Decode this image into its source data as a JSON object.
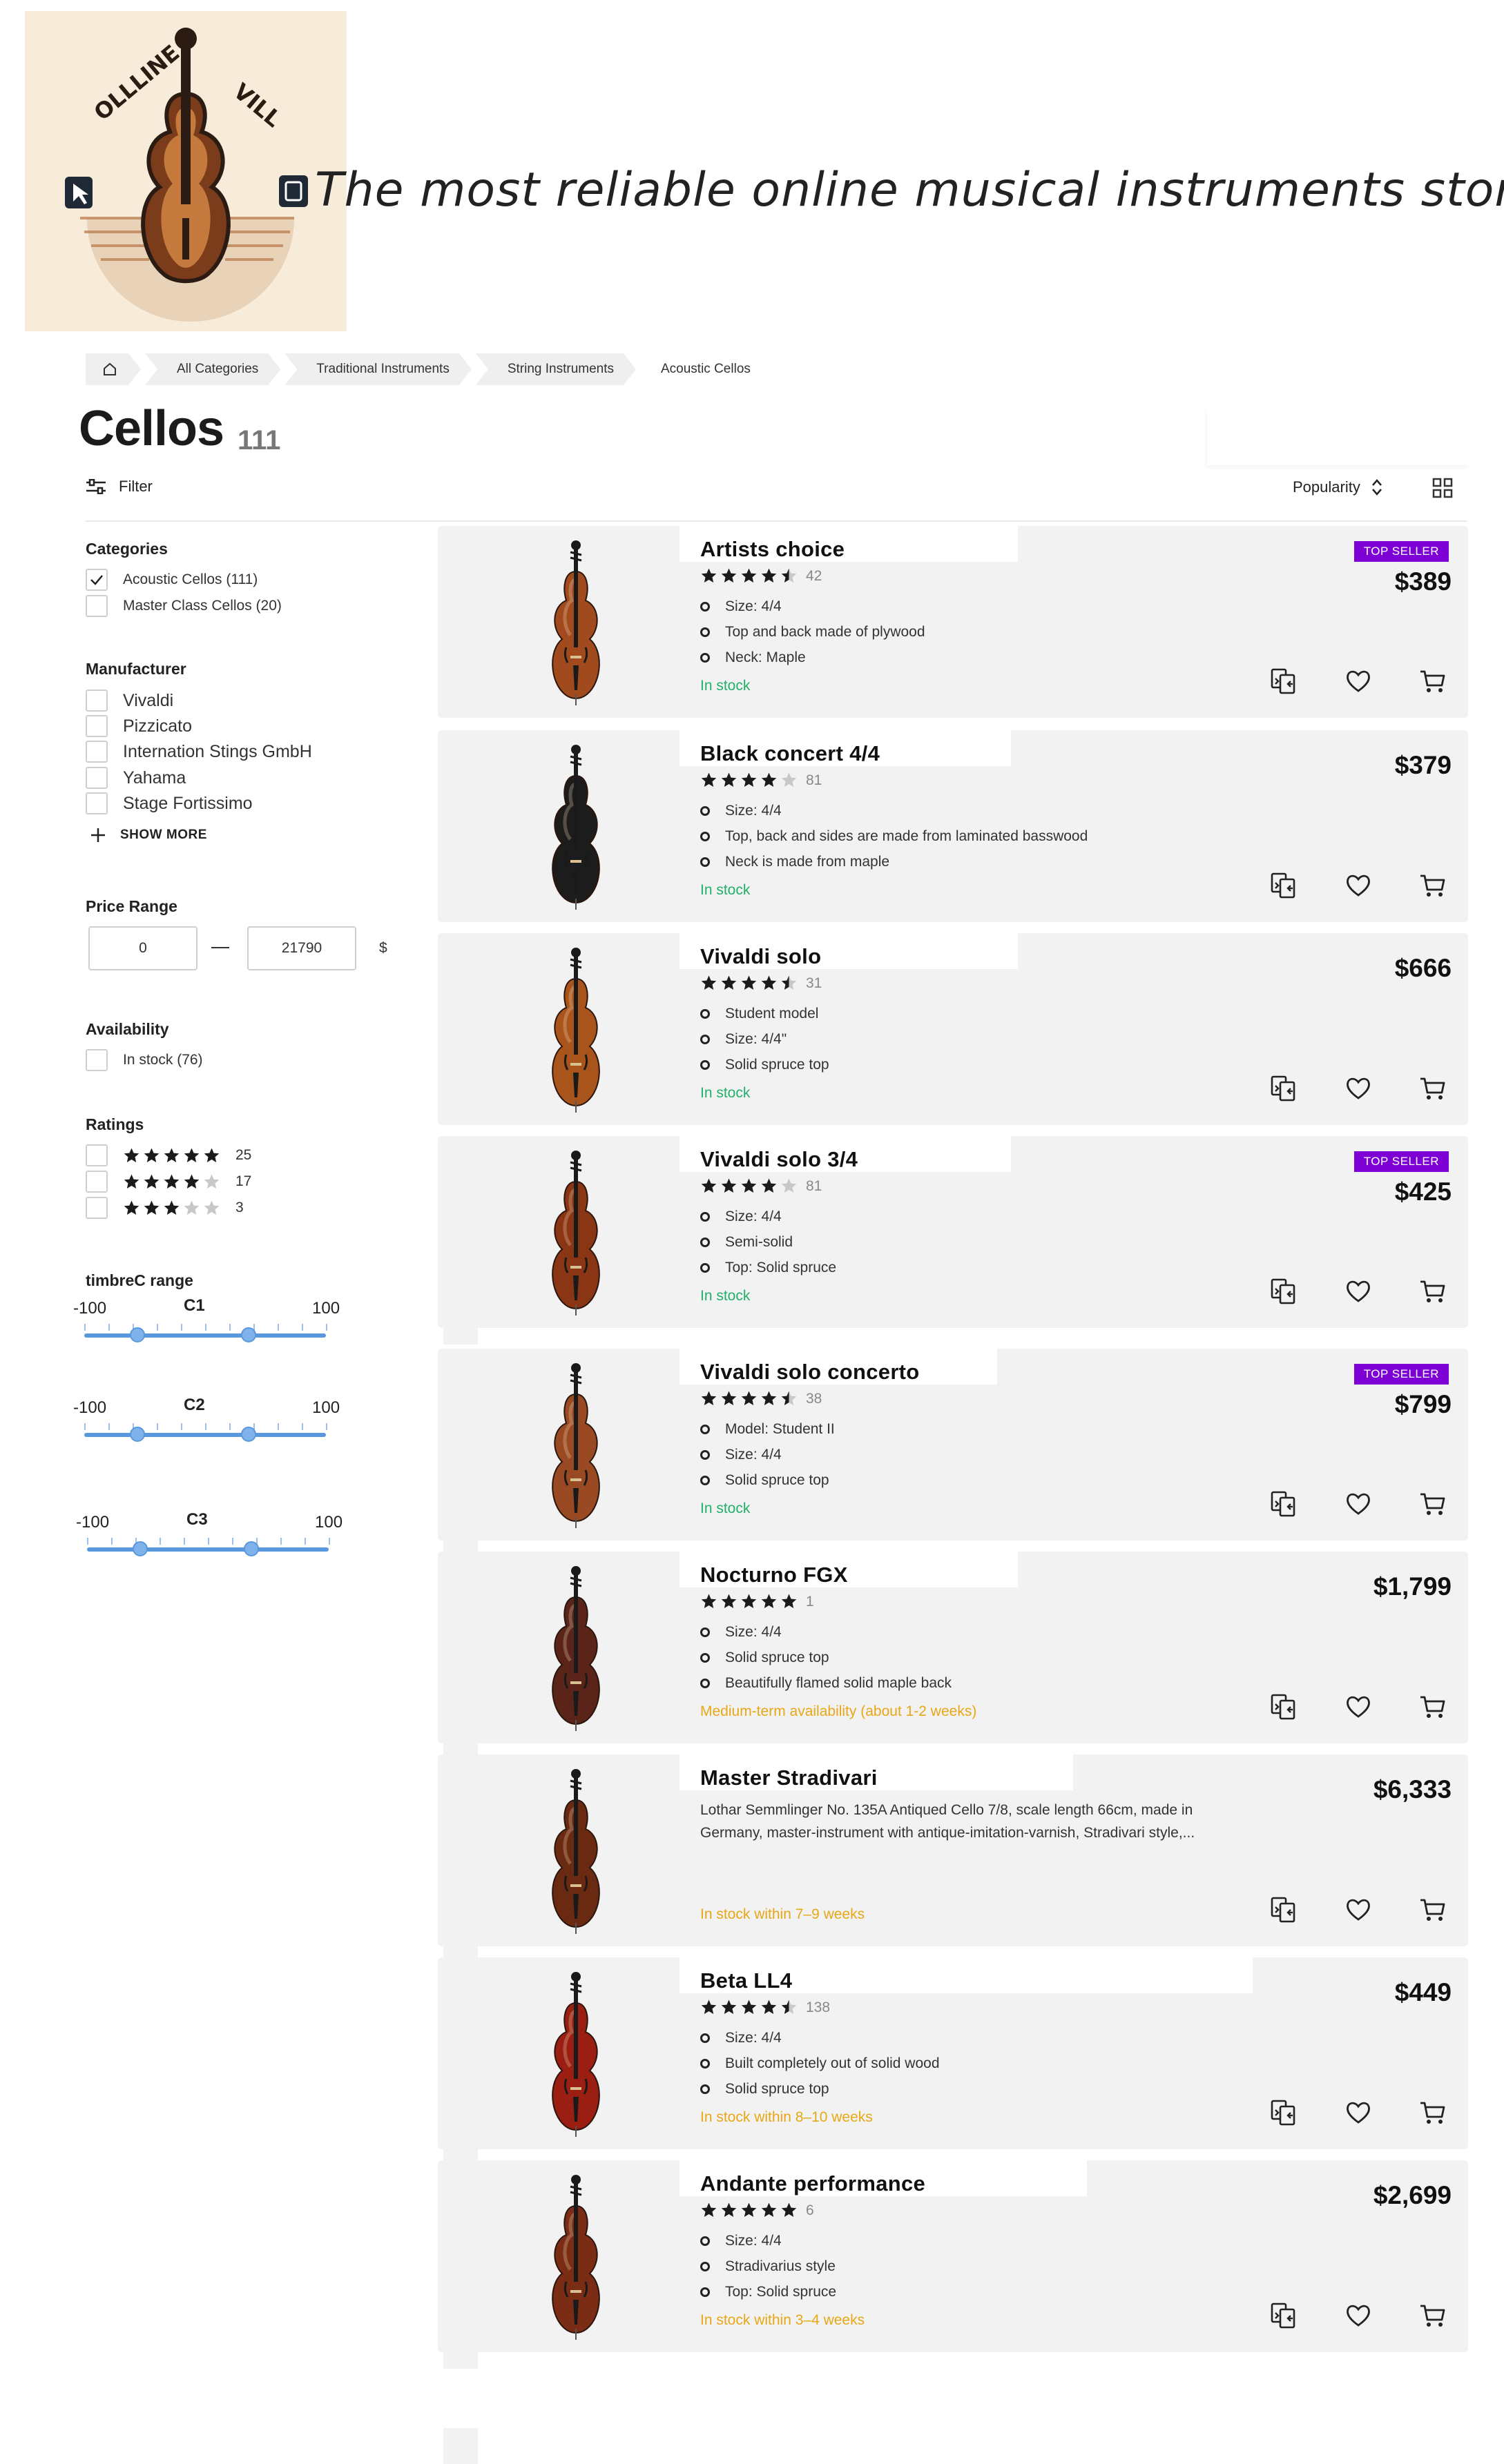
{
  "header": {
    "logo_text": "OLLLINE VILL",
    "tagline": "The most reliable online musical instruments store"
  },
  "breadcrumb": [
    "All Categories",
    "Traditional Instruments",
    "String Instruments",
    "Acoustic Cellos"
  ],
  "page": {
    "title": "Cellos",
    "count": "111"
  },
  "toolbar": {
    "filter_label": "Filter",
    "sort_label": "Popularity"
  },
  "sidebar": {
    "categories": {
      "heading": "Categories",
      "items": [
        {
          "label": "Acoustic Cellos (111)",
          "checked": true
        },
        {
          "label": "Master Class Cellos (20)",
          "checked": false
        }
      ]
    },
    "manufacturer": {
      "heading": "Manufacturer",
      "items": [
        "Vivaldi",
        "Pizzicato",
        "Internation Stings GmbH",
        "Yahama",
        "Stage Fortissimo"
      ],
      "show_more": "SHOW MORE"
    },
    "price": {
      "heading": "Price Range",
      "min": "0",
      "max": "21790",
      "currency": "$"
    },
    "availability": {
      "heading": "Availability",
      "items": [
        "In stock (76)"
      ]
    },
    "ratings": {
      "heading": "Ratings",
      "items": [
        {
          "stars": 5,
          "count": "25"
        },
        {
          "stars": 4,
          "count": "17"
        },
        {
          "stars": 3,
          "count": "3"
        }
      ]
    },
    "timbre": {
      "heading": "timbreC range",
      "sliders": [
        {
          "name": "C1",
          "min": "-100",
          "max": "100",
          "low_pct": 22,
          "high_pct": 68
        },
        {
          "name": "C2",
          "min": "-100",
          "max": "100",
          "low_pct": 22,
          "high_pct": 68
        },
        {
          "name": "C3",
          "min": "-100",
          "max": "100",
          "low_pct": 22,
          "high_pct": 68
        }
      ]
    }
  },
  "products": [
    {
      "name": "Artists choice",
      "rating": 4.5,
      "reviews": "42",
      "features": [
        "Size: 4/4",
        "Top and back made of plywood",
        "Neck: Maple"
      ],
      "availability": "In stock",
      "avail_status": "ok",
      "price": "$389",
      "badge": "TOP SELLER",
      "wood": "#a04a1e"
    },
    {
      "name": "Black  concert 4/4",
      "rating": 4,
      "reviews": "81",
      "features": [
        "Size: 4/4",
        "Top, back and sides are made from laminated basswood",
        "Neck is made from maple"
      ],
      "availability": "In stock",
      "avail_status": "ok",
      "price": "$379",
      "badge": "",
      "wood": "#1c1c1c"
    },
    {
      "name": "Vivaldi solo",
      "rating": 4.5,
      "reviews": "31",
      "features": [
        "Student model",
        "Size: 4/4\"",
        "Solid spruce top"
      ],
      "availability": "In stock",
      "avail_status": "ok",
      "price": "$666",
      "badge": "",
      "wood": "#a8541a"
    },
    {
      "name": "Vivaldi solo 3/4",
      "rating": 4,
      "reviews": "81",
      "features": [
        "Size: 4/4",
        "Semi-solid",
        "Top: Solid spruce"
      ],
      "availability": "In stock",
      "avail_status": "ok",
      "price": "$425",
      "badge": "TOP SELLER",
      "wood": "#8a3514"
    },
    {
      "name": "Vivaldi solo concerto",
      "rating": 4.5,
      "reviews": "38",
      "features": [
        "Model: Student II",
        "Size: 4/4",
        "Solid spruce top"
      ],
      "availability": "In stock",
      "avail_status": "ok",
      "price": "$799",
      "badge": "TOP SELLER",
      "wood": "#9a4a22"
    },
    {
      "name": "Nocturno FGX",
      "rating": 5,
      "reviews": "1",
      "features": [
        "Size: 4/4",
        "Solid spruce top",
        "Beautifully flamed solid maple back"
      ],
      "availability": "Medium-term availability (about 1-2 weeks)",
      "avail_status": "warn",
      "price": "$1,799",
      "badge": "",
      "wood": "#5a2418"
    },
    {
      "name": "Master Stradivari",
      "rating": 0,
      "reviews": "",
      "features": [],
      "description": "Lothar Semmlinger No. 135A Antiqued Cello 7/8, scale length 66cm, made in Germany, master-instrument with antique-imitation-varnish, Stradivari style,...",
      "availability": "In stock within 7–9 weeks",
      "avail_status": "warn",
      "price": "$6,333",
      "badge": "",
      "wood": "#6a2a12"
    },
    {
      "name": "Beta LL4",
      "rating": 4.5,
      "reviews": "138",
      "features": [
        "Size: 4/4",
        "Built completely out of solid wood",
        "Solid spruce top"
      ],
      "availability": "In stock within 8–10 weeks",
      "avail_status": "warn",
      "price": "$449",
      "badge": "",
      "wood": "#9a1f12"
    },
    {
      "name": "Andante performance",
      "rating": 5,
      "reviews": "6",
      "features": [
        "Size: 4/4",
        "Stradivarius style",
        "Top: Solid spruce"
      ],
      "availability": "In stock within 3–4 weeks",
      "avail_status": "warn",
      "price": "$2,699",
      "badge": "",
      "wood": "#7a2c14"
    }
  ],
  "icons": {
    "compare": "compare-icon",
    "wishlist": "heart-icon",
    "cart": "cart-icon"
  },
  "colors": {
    "badge": "#7d00d4",
    "in_stock": "#21b06a",
    "delayed": "#e8a716",
    "slider": "#5a98dd"
  }
}
